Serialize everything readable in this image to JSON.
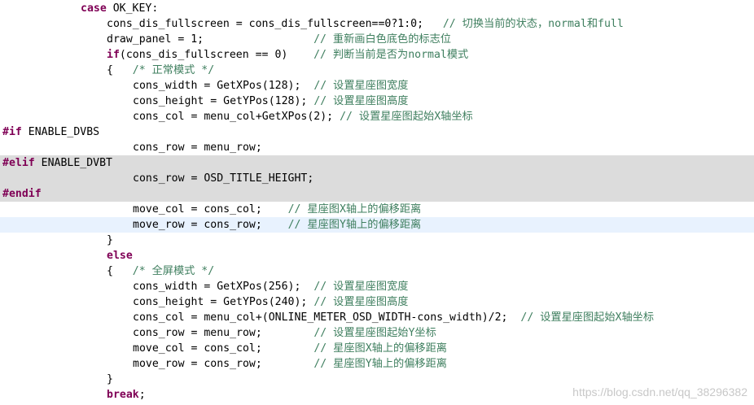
{
  "editor": {
    "lines": [
      {
        "indent": 99,
        "bg": "",
        "segs": [
          {
            "c": "kw",
            "t": "case"
          },
          {
            "c": "",
            "t": " OK_KEY:"
          }
        ]
      },
      {
        "indent": 131,
        "bg": "",
        "segs": [
          {
            "c": "",
            "t": "cons_dis_fullscreen = cons_dis_fullscreen==0?1:0;   "
          },
          {
            "c": "cm",
            "t": "// 切换当前的状态，normal和full"
          }
        ]
      },
      {
        "indent": 131,
        "bg": "",
        "segs": [
          {
            "c": "",
            "t": "draw_panel = 1;                 "
          },
          {
            "c": "cm",
            "t": "// 重新画白色底色的标志位"
          }
        ]
      },
      {
        "indent": 131,
        "bg": "",
        "segs": [
          {
            "c": "kw",
            "t": "if"
          },
          {
            "c": "",
            "t": "(cons_dis_fullscreen == 0)    "
          },
          {
            "c": "cm",
            "t": "// 判断当前是否为normal模式"
          }
        ]
      },
      {
        "indent": 131,
        "bg": "",
        "segs": [
          {
            "c": "",
            "t": "{   "
          },
          {
            "c": "cm",
            "t": "/* 正常模式 */"
          }
        ]
      },
      {
        "indent": 163,
        "bg": "",
        "segs": [
          {
            "c": "",
            "t": "cons_width = GetXPos(128);  "
          },
          {
            "c": "cm",
            "t": "// 设置星座图宽度"
          }
        ]
      },
      {
        "indent": 163,
        "bg": "",
        "segs": [
          {
            "c": "",
            "t": "cons_height = GetYPos(128); "
          },
          {
            "c": "cm",
            "t": "// 设置星座图高度"
          }
        ]
      },
      {
        "indent": 163,
        "bg": "",
        "segs": [
          {
            "c": "",
            "t": "cons_col = menu_col+GetXPos(2); "
          },
          {
            "c": "cm",
            "t": "// 设置星座图起始X轴坐标"
          }
        ]
      },
      {
        "indent": 3,
        "bg": "",
        "segs": [
          {
            "c": "pp",
            "t": "#if"
          },
          {
            "c": "",
            "t": " ENABLE_DVBS"
          }
        ]
      },
      {
        "indent": 163,
        "bg": "",
        "segs": [
          {
            "c": "",
            "t": "cons_row = menu_row;"
          }
        ]
      },
      {
        "indent": 3,
        "bg": "inactive",
        "segs": [
          {
            "c": "pp",
            "t": "#elif"
          },
          {
            "c": "",
            "t": " ENABLE_DVBT"
          }
        ]
      },
      {
        "indent": 163,
        "bg": "inactive",
        "segs": [
          {
            "c": "",
            "t": "cons_row = OSD_TITLE_HEIGHT;"
          }
        ]
      },
      {
        "indent": 3,
        "bg": "inactive",
        "segs": [
          {
            "c": "pp",
            "t": "#endif"
          }
        ]
      },
      {
        "indent": 163,
        "bg": "",
        "segs": [
          {
            "c": "",
            "t": "move_col = cons_col;    "
          },
          {
            "c": "cm",
            "t": "// 星座图X轴上的偏移距离"
          }
        ]
      },
      {
        "indent": 163,
        "bg": "current",
        "segs": [
          {
            "c": "",
            "t": "move_row = cons_row;    "
          },
          {
            "c": "cm",
            "t": "// 星座图Y轴上的偏移距离"
          }
        ]
      },
      {
        "indent": 131,
        "bg": "",
        "segs": [
          {
            "c": "",
            "t": "}"
          }
        ]
      },
      {
        "indent": 131,
        "bg": "",
        "segs": [
          {
            "c": "kw",
            "t": "else"
          }
        ]
      },
      {
        "indent": 131,
        "bg": "",
        "segs": [
          {
            "c": "",
            "t": "{   "
          },
          {
            "c": "cm",
            "t": "/* 全屏模式 */"
          }
        ]
      },
      {
        "indent": 163,
        "bg": "",
        "segs": [
          {
            "c": "",
            "t": "cons_width = GetXPos(256);  "
          },
          {
            "c": "cm",
            "t": "// 设置星座图宽度"
          }
        ]
      },
      {
        "indent": 163,
        "bg": "",
        "segs": [
          {
            "c": "",
            "t": "cons_height = GetYPos(240); "
          },
          {
            "c": "cm",
            "t": "// 设置星座图高度"
          }
        ]
      },
      {
        "indent": 163,
        "bg": "",
        "segs": [
          {
            "c": "",
            "t": "cons_col = menu_col+(ONLINE_METER_OSD_WIDTH-cons_width)/2;  "
          },
          {
            "c": "cm",
            "t": "// 设置星座图起始X轴坐标"
          }
        ]
      },
      {
        "indent": 163,
        "bg": "",
        "segs": [
          {
            "c": "",
            "t": "cons_row = menu_row;        "
          },
          {
            "c": "cm",
            "t": "// 设置星座图起始Y坐标"
          }
        ]
      },
      {
        "indent": 163,
        "bg": "",
        "segs": [
          {
            "c": "",
            "t": "move_col = cons_col;        "
          },
          {
            "c": "cm",
            "t": "// 星座图X轴上的偏移距离"
          }
        ]
      },
      {
        "indent": 163,
        "bg": "",
        "segs": [
          {
            "c": "",
            "t": "move_row = cons_row;        "
          },
          {
            "c": "cm",
            "t": "// 星座图Y轴上的偏移距离"
          }
        ]
      },
      {
        "indent": 131,
        "bg": "",
        "segs": [
          {
            "c": "",
            "t": "}"
          }
        ]
      },
      {
        "indent": 131,
        "bg": "",
        "segs": [
          {
            "c": "kw",
            "t": "break"
          },
          {
            "c": "",
            "t": ";"
          }
        ]
      }
    ]
  },
  "watermark": "https://blog.csdn.net/qq_38296382"
}
